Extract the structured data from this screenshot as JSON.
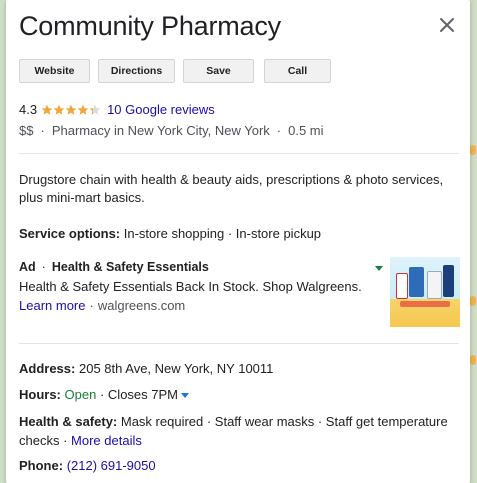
{
  "place": {
    "title": "Community Pharmacy"
  },
  "actions": {
    "website": "Website",
    "directions": "Directions",
    "save": "Save",
    "call": "Call"
  },
  "rating": {
    "score": "4.3",
    "stars_filled": 4.3,
    "reviews_link": "10 Google reviews"
  },
  "meta": {
    "price": "$$",
    "category": "Pharmacy in New York City, New York",
    "distance": "0.5 mi"
  },
  "description": "Drugstore chain with health & beauty aids, prescriptions & photo services, plus mini-mart basics.",
  "service_options": {
    "label": "Service options:",
    "value": "In-store shopping · In-store pickup"
  },
  "ad": {
    "tag": "Ad",
    "title": "Health & Safety Essentials",
    "text": "Health & Safety Essentials Back In Stock. Shop Walgreens.",
    "learn_more": "Learn more",
    "host": "walgreens.com"
  },
  "address": {
    "label": "Address:",
    "value": "205 8th Ave, New York, NY 10011"
  },
  "hours": {
    "label": "Hours:",
    "status": "Open",
    "closes": "Closes 7PM"
  },
  "health_safety": {
    "label": "Health & safety:",
    "value": "Mask required · Staff wear masks · Staff get temperature checks ·",
    "more": "More details"
  },
  "phone": {
    "label": "Phone:",
    "value": "(212) 691-9050"
  },
  "colors": {
    "link": "#1a0dab",
    "open": "#188038",
    "star": "#f2a73b"
  },
  "icons": {
    "close": "close-icon",
    "star": "star-icon",
    "ad_menu": "triangle-down-icon",
    "hours_menu": "chevron-down-icon"
  }
}
